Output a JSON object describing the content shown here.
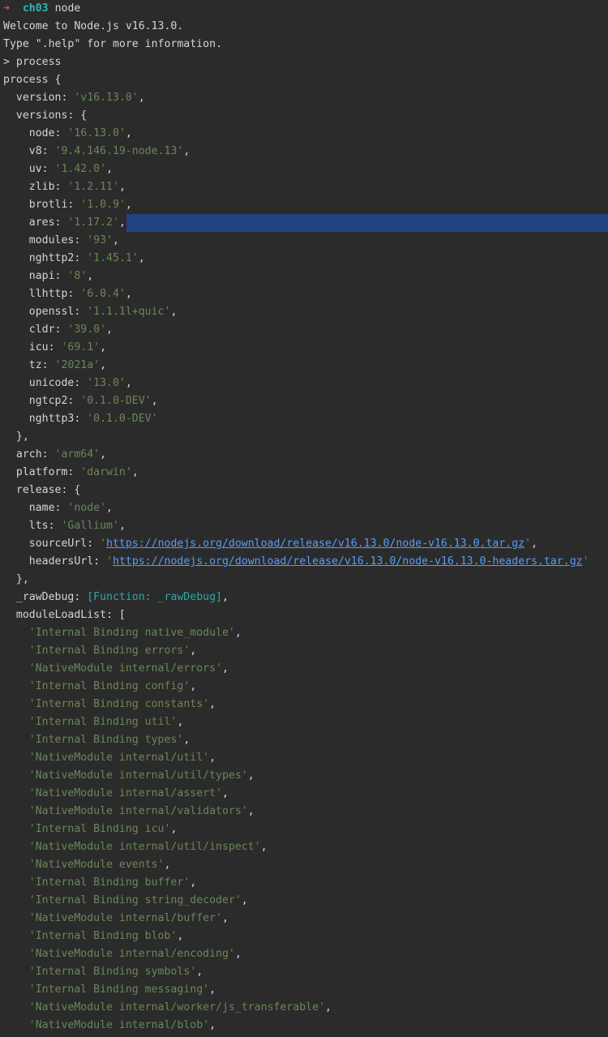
{
  "prompt": {
    "arrow": "➜",
    "directory": "ch03",
    "command": "node"
  },
  "lines": [
    {
      "parts": [
        {
          "t": "plain",
          "v": "Welcome to Node.js v16.13.0."
        }
      ]
    },
    {
      "parts": [
        {
          "t": "plain",
          "v": "Type \".help\" for more information."
        }
      ]
    },
    {
      "parts": [
        {
          "t": "plain",
          "v": "> process"
        }
      ]
    },
    {
      "parts": [
        {
          "t": "plain",
          "v": "process {"
        }
      ]
    },
    {
      "parts": [
        {
          "t": "plain",
          "v": "  version: "
        },
        {
          "t": "str",
          "v": "'v16.13.0'"
        },
        {
          "t": "plain",
          "v": ","
        }
      ]
    },
    {
      "parts": [
        {
          "t": "plain",
          "v": "  versions: {"
        }
      ]
    },
    {
      "parts": [
        {
          "t": "plain",
          "v": "    node: "
        },
        {
          "t": "str",
          "v": "'16.13.0'"
        },
        {
          "t": "plain",
          "v": ","
        }
      ]
    },
    {
      "parts": [
        {
          "t": "plain",
          "v": "    v8: "
        },
        {
          "t": "str",
          "v": "'9.4.146.19-node.13'"
        },
        {
          "t": "plain",
          "v": ","
        }
      ]
    },
    {
      "parts": [
        {
          "t": "plain",
          "v": "    uv: "
        },
        {
          "t": "str",
          "v": "'1.42.0'"
        },
        {
          "t": "plain",
          "v": ","
        }
      ]
    },
    {
      "parts": [
        {
          "t": "plain",
          "v": "    zlib: "
        },
        {
          "t": "str",
          "v": "'1.2.11'"
        },
        {
          "t": "plain",
          "v": ","
        }
      ]
    },
    {
      "parts": [
        {
          "t": "plain",
          "v": "    brotli: "
        },
        {
          "t": "str",
          "v": "'1.0.9'"
        },
        {
          "t": "plain",
          "v": ","
        }
      ]
    },
    {
      "parts": [
        {
          "t": "plain",
          "v": "    ares: "
        },
        {
          "t": "str",
          "v": "'1.17.2'"
        },
        {
          "t": "plain",
          "v": ","
        }
      ]
    },
    {
      "parts": [
        {
          "t": "plain",
          "v": "    modules: "
        },
        {
          "t": "str",
          "v": "'93'"
        },
        {
          "t": "plain",
          "v": ","
        }
      ]
    },
    {
      "parts": [
        {
          "t": "plain",
          "v": "    nghttp2: "
        },
        {
          "t": "str",
          "v": "'1.45.1'"
        },
        {
          "t": "plain",
          "v": ","
        }
      ]
    },
    {
      "parts": [
        {
          "t": "plain",
          "v": "    napi: "
        },
        {
          "t": "str",
          "v": "'8'"
        },
        {
          "t": "plain",
          "v": ","
        }
      ]
    },
    {
      "parts": [
        {
          "t": "plain",
          "v": "    llhttp: "
        },
        {
          "t": "str",
          "v": "'6.0.4'"
        },
        {
          "t": "plain",
          "v": ","
        }
      ]
    },
    {
      "parts": [
        {
          "t": "plain",
          "v": "    openssl: "
        },
        {
          "t": "str",
          "v": "'1.1.1l+quic'"
        },
        {
          "t": "plain",
          "v": ","
        }
      ]
    },
    {
      "parts": [
        {
          "t": "plain",
          "v": "    cldr: "
        },
        {
          "t": "str",
          "v": "'39.0'"
        },
        {
          "t": "plain",
          "v": ","
        }
      ]
    },
    {
      "parts": [
        {
          "t": "plain",
          "v": "    icu: "
        },
        {
          "t": "str",
          "v": "'69.1'"
        },
        {
          "t": "plain",
          "v": ","
        }
      ]
    },
    {
      "parts": [
        {
          "t": "plain",
          "v": "    tz: "
        },
        {
          "t": "str",
          "v": "'2021a'"
        },
        {
          "t": "plain",
          "v": ","
        }
      ]
    },
    {
      "parts": [
        {
          "t": "plain",
          "v": "    unicode: "
        },
        {
          "t": "str",
          "v": "'13.0'"
        },
        {
          "t": "plain",
          "v": ","
        }
      ]
    },
    {
      "parts": [
        {
          "t": "plain",
          "v": "    ngtcp2: "
        },
        {
          "t": "str",
          "v": "'0.1.0-DEV'"
        },
        {
          "t": "plain",
          "v": ","
        }
      ]
    },
    {
      "parts": [
        {
          "t": "plain",
          "v": "    nghttp3: "
        },
        {
          "t": "str",
          "v": "'0.1.0-DEV'"
        }
      ]
    },
    {
      "parts": [
        {
          "t": "plain",
          "v": "  },"
        }
      ]
    },
    {
      "parts": [
        {
          "t": "plain",
          "v": "  arch: "
        },
        {
          "t": "str",
          "v": "'arm64'"
        },
        {
          "t": "plain",
          "v": ","
        }
      ]
    },
    {
      "parts": [
        {
          "t": "plain",
          "v": "  platform: "
        },
        {
          "t": "str",
          "v": "'darwin'"
        },
        {
          "t": "plain",
          "v": ","
        }
      ]
    },
    {
      "parts": [
        {
          "t": "plain",
          "v": "  release: {"
        }
      ]
    },
    {
      "parts": [
        {
          "t": "plain",
          "v": "    name: "
        },
        {
          "t": "str",
          "v": "'node'"
        },
        {
          "t": "plain",
          "v": ","
        }
      ]
    },
    {
      "parts": [
        {
          "t": "plain",
          "v": "    lts: "
        },
        {
          "t": "str",
          "v": "'Gallium'"
        },
        {
          "t": "plain",
          "v": ","
        }
      ]
    },
    {
      "parts": [
        {
          "t": "plain",
          "v": "    sourceUrl: "
        },
        {
          "t": "str",
          "v": "'"
        },
        {
          "t": "url",
          "v": "https://nodejs.org/download/release/v16.13.0/node-v16.13.0.tar.gz"
        },
        {
          "t": "str",
          "v": "'"
        },
        {
          "t": "plain",
          "v": ","
        }
      ]
    },
    {
      "parts": [
        {
          "t": "plain",
          "v": "    headersUrl: "
        },
        {
          "t": "str",
          "v": "'"
        },
        {
          "t": "url",
          "v": "https://nodejs.org/download/release/v16.13.0/node-v16.13.0-headers.tar.gz"
        },
        {
          "t": "str",
          "v": "'"
        }
      ]
    },
    {
      "parts": [
        {
          "t": "plain",
          "v": "  },"
        }
      ]
    },
    {
      "parts": [
        {
          "t": "plain",
          "v": "  _rawDebug: "
        },
        {
          "t": "fn",
          "v": "[Function: _rawDebug]"
        },
        {
          "t": "plain",
          "v": ","
        }
      ]
    },
    {
      "parts": [
        {
          "t": "plain",
          "v": "  moduleLoadList: ["
        }
      ]
    },
    {
      "parts": [
        {
          "t": "plain",
          "v": "    "
        },
        {
          "t": "str",
          "v": "'Internal Binding native_module'"
        },
        {
          "t": "plain",
          "v": ","
        }
      ]
    },
    {
      "parts": [
        {
          "t": "plain",
          "v": "    "
        },
        {
          "t": "str",
          "v": "'Internal Binding errors'"
        },
        {
          "t": "plain",
          "v": ","
        }
      ]
    },
    {
      "parts": [
        {
          "t": "plain",
          "v": "    "
        },
        {
          "t": "str",
          "v": "'NativeModule internal/errors'"
        },
        {
          "t": "plain",
          "v": ","
        }
      ]
    },
    {
      "parts": [
        {
          "t": "plain",
          "v": "    "
        },
        {
          "t": "str",
          "v": "'Internal Binding config'"
        },
        {
          "t": "plain",
          "v": ","
        }
      ]
    },
    {
      "parts": [
        {
          "t": "plain",
          "v": "    "
        },
        {
          "t": "str",
          "v": "'Internal Binding constants'"
        },
        {
          "t": "plain",
          "v": ","
        }
      ]
    },
    {
      "parts": [
        {
          "t": "plain",
          "v": "    "
        },
        {
          "t": "str",
          "v": "'Internal Binding util'"
        },
        {
          "t": "plain",
          "v": ","
        }
      ]
    },
    {
      "parts": [
        {
          "t": "plain",
          "v": "    "
        },
        {
          "t": "str",
          "v": "'Internal Binding types'"
        },
        {
          "t": "plain",
          "v": ","
        }
      ]
    },
    {
      "parts": [
        {
          "t": "plain",
          "v": "    "
        },
        {
          "t": "str",
          "v": "'NativeModule internal/util'"
        },
        {
          "t": "plain",
          "v": ","
        }
      ]
    },
    {
      "parts": [
        {
          "t": "plain",
          "v": "    "
        },
        {
          "t": "str",
          "v": "'NativeModule internal/util/types'"
        },
        {
          "t": "plain",
          "v": ","
        }
      ]
    },
    {
      "parts": [
        {
          "t": "plain",
          "v": "    "
        },
        {
          "t": "str",
          "v": "'NativeModule internal/assert'"
        },
        {
          "t": "plain",
          "v": ","
        }
      ]
    },
    {
      "parts": [
        {
          "t": "plain",
          "v": "    "
        },
        {
          "t": "str",
          "v": "'NativeModule internal/validators'"
        },
        {
          "t": "plain",
          "v": ","
        }
      ]
    },
    {
      "parts": [
        {
          "t": "plain",
          "v": "    "
        },
        {
          "t": "str",
          "v": "'Internal Binding icu'"
        },
        {
          "t": "plain",
          "v": ","
        }
      ]
    },
    {
      "parts": [
        {
          "t": "plain",
          "v": "    "
        },
        {
          "t": "str",
          "v": "'NativeModule internal/util/inspect'"
        },
        {
          "t": "plain",
          "v": ","
        }
      ]
    },
    {
      "parts": [
        {
          "t": "plain",
          "v": "    "
        },
        {
          "t": "str",
          "v": "'NativeModule events'"
        },
        {
          "t": "plain",
          "v": ","
        }
      ]
    },
    {
      "parts": [
        {
          "t": "plain",
          "v": "    "
        },
        {
          "t": "str",
          "v": "'Internal Binding buffer'"
        },
        {
          "t": "plain",
          "v": ","
        }
      ]
    },
    {
      "parts": [
        {
          "t": "plain",
          "v": "    "
        },
        {
          "t": "str",
          "v": "'Internal Binding string_decoder'"
        },
        {
          "t": "plain",
          "v": ","
        }
      ]
    },
    {
      "parts": [
        {
          "t": "plain",
          "v": "    "
        },
        {
          "t": "str",
          "v": "'NativeModule internal/buffer'"
        },
        {
          "t": "plain",
          "v": ","
        }
      ]
    },
    {
      "parts": [
        {
          "t": "plain",
          "v": "    "
        },
        {
          "t": "str",
          "v": "'Internal Binding blob'"
        },
        {
          "t": "plain",
          "v": ","
        }
      ]
    },
    {
      "parts": [
        {
          "t": "plain",
          "v": "    "
        },
        {
          "t": "str",
          "v": "'NativeModule internal/encoding'"
        },
        {
          "t": "plain",
          "v": ","
        }
      ]
    },
    {
      "parts": [
        {
          "t": "plain",
          "v": "    "
        },
        {
          "t": "str",
          "v": "'Internal Binding symbols'"
        },
        {
          "t": "plain",
          "v": ","
        }
      ]
    },
    {
      "parts": [
        {
          "t": "plain",
          "v": "    "
        },
        {
          "t": "str",
          "v": "'Internal Binding messaging'"
        },
        {
          "t": "plain",
          "v": ","
        }
      ]
    },
    {
      "parts": [
        {
          "t": "plain",
          "v": "    "
        },
        {
          "t": "str",
          "v": "'NativeModule internal/worker/js_transferable'"
        },
        {
          "t": "plain",
          "v": ","
        }
      ]
    },
    {
      "parts": [
        {
          "t": "plain",
          "v": "    "
        },
        {
          "t": "str",
          "v": "'NativeModule internal/blob'"
        },
        {
          "t": "plain",
          "v": ","
        }
      ]
    }
  ],
  "colors": {
    "background": "#2b2b2b",
    "text": "#d4d4d4",
    "string": "#6a8759",
    "function": "#2fa6a6",
    "url": "#589df6",
    "prompt_arrow": "#e0505a",
    "prompt_dir": "#2fb5b5",
    "selection": "#214283"
  }
}
